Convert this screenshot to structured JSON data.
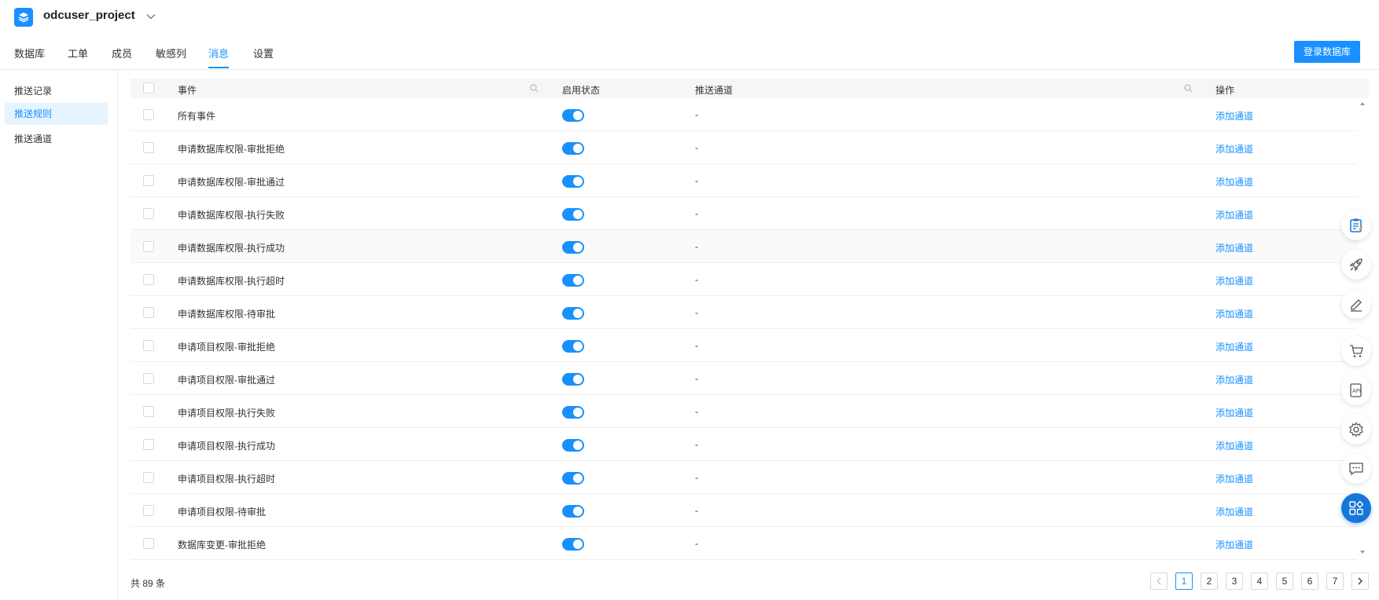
{
  "header": {
    "project_name": "odcuser_project",
    "project_icon": "layers-icon"
  },
  "tabs": [
    {
      "label": "数据库",
      "active": false
    },
    {
      "label": "工单",
      "active": false
    },
    {
      "label": "成员",
      "active": false
    },
    {
      "label": "敏感列",
      "active": false
    },
    {
      "label": "消息",
      "active": true
    },
    {
      "label": "设置",
      "active": false
    }
  ],
  "toolbar": {
    "login_db_label": "登录数据库"
  },
  "sidebar": {
    "items": [
      {
        "label": "推送记录",
        "active": false
      },
      {
        "label": "推送规则",
        "active": true
      },
      {
        "label": "推送通道",
        "active": false
      }
    ]
  },
  "table": {
    "columns": {
      "event": "事件",
      "status": "启用状态",
      "channel": "推送通道",
      "action": "操作"
    },
    "rows": [
      {
        "event": "所有事件",
        "enabled": true,
        "channel": "-",
        "action": "添加通道"
      },
      {
        "event": "申请数据库权限-审批拒绝",
        "enabled": true,
        "channel": "-",
        "action": "添加通道"
      },
      {
        "event": "申请数据库权限-审批通过",
        "enabled": true,
        "channel": "-",
        "action": "添加通道"
      },
      {
        "event": "申请数据库权限-执行失败",
        "enabled": true,
        "channel": "-",
        "action": "添加通道"
      },
      {
        "event": "申请数据库权限-执行成功",
        "enabled": true,
        "channel": "-",
        "action": "添加通道"
      },
      {
        "event": "申请数据库权限-执行超时",
        "enabled": true,
        "channel": "-",
        "action": "添加通道"
      },
      {
        "event": "申请数据库权限-待审批",
        "enabled": true,
        "channel": "-",
        "action": "添加通道"
      },
      {
        "event": "申请项目权限-审批拒绝",
        "enabled": true,
        "channel": "-",
        "action": "添加通道"
      },
      {
        "event": "申请项目权限-审批通过",
        "enabled": true,
        "channel": "-",
        "action": "添加通道"
      },
      {
        "event": "申请项目权限-执行失败",
        "enabled": true,
        "channel": "-",
        "action": "添加通道"
      },
      {
        "event": "申请项目权限-执行成功",
        "enabled": true,
        "channel": "-",
        "action": "添加通道"
      },
      {
        "event": "申请项目权限-执行超时",
        "enabled": true,
        "channel": "-",
        "action": "添加通道"
      },
      {
        "event": "申请项目权限-待审批",
        "enabled": true,
        "channel": "-",
        "action": "添加通道"
      },
      {
        "event": "数据库变更-审批拒绝",
        "enabled": true,
        "channel": "-",
        "action": "添加通道"
      }
    ]
  },
  "footer": {
    "total": "共 89 条",
    "pages": [
      "1",
      "2",
      "3",
      "4",
      "5",
      "6",
      "7"
    ],
    "current_page": "1"
  },
  "tools": [
    "clipboard-icon",
    "rocket-icon",
    "edit-icon",
    "cart-icon",
    "api-doc-icon",
    "gear-icon",
    "chat-icon",
    "apps-icon"
  ],
  "colors": {
    "accent": "#1890ff",
    "active_bg": "#e6f4ff"
  }
}
